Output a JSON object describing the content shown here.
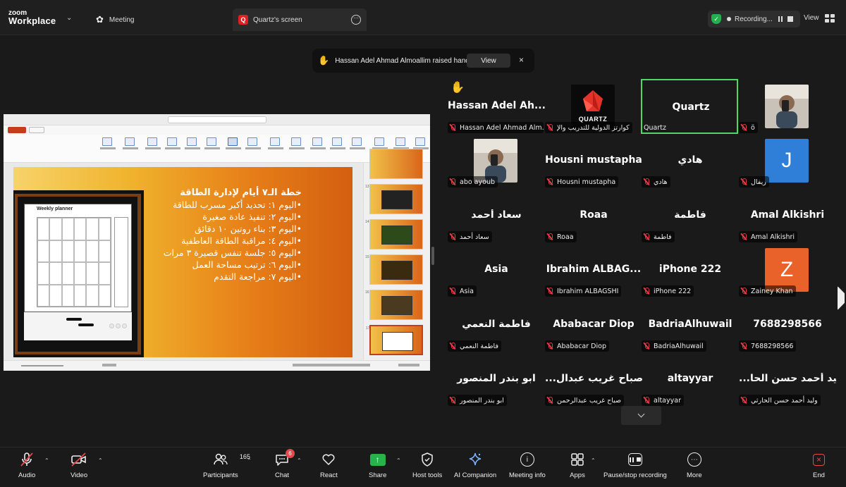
{
  "app": {
    "logo_line1": "zoom",
    "logo_line2": "Workplace"
  },
  "tabs": {
    "meeting": "Meeting",
    "screen": "Quartz's screen",
    "screen_icon_letter": "Q"
  },
  "recording": {
    "label": "Recording...",
    "view_label": "View"
  },
  "notification": {
    "text": "Hassan Adel Ahmad Almoallim raised hand",
    "view_button": "View",
    "close": "×"
  },
  "shared_slide": {
    "title": "خطة الـ٧ أيام لإدارة الطاقة",
    "lines": [
      "•اليوم ١: تحديد أكبر مسرب للطاقة",
      "•اليوم ٢: تنفيذ عادة صغيرة",
      "•اليوم ٣: بناء روتين ١٠ دقائق",
      "•اليوم ٤: مراقبة الطاقة العاطفية",
      "•اليوم ٥: جلسة تنفس قصيرة ٣ مرات",
      "•اليوم ٦: ترتيب مساحة العمل",
      "•اليوم ٧: مراجعة التقدم"
    ],
    "planner_title": "Weekly planner",
    "thumb_numbers": [
      "13",
      "14",
      "15",
      "16",
      "17"
    ]
  },
  "participants": [
    {
      "name": "Hassan  Adel  Ah...",
      "label": "Hassan Adel Ahmad Alm...",
      "raised_hand": true
    },
    {
      "name": "",
      "label": "كوارتز الدولية للتدريب والإ",
      "avatar_type": "quartz-logo",
      "logo_text": "QUARTZ"
    },
    {
      "name": "Quartz",
      "label": "Quartz",
      "active_speaker": true
    },
    {
      "name": "",
      "label": "ö",
      "avatar_type": "photo"
    },
    {
      "name": "",
      "label": "abo ayoub",
      "avatar_type": "photo"
    },
    {
      "name": "Housni mustapha",
      "label": "Housni mustapha"
    },
    {
      "name": "هادي",
      "label": "هادي"
    },
    {
      "name": "",
      "label": "ريفال",
      "avatar_type": "letter",
      "letter": "J",
      "color": "#2f7fd8"
    },
    {
      "name": "سعاد أحمد",
      "label": "سعاد أحمد"
    },
    {
      "name": "Roaa",
      "label": "Roaa"
    },
    {
      "name": "فاطمة",
      "label": "فاطمة"
    },
    {
      "name": "Amal Alkishri",
      "label": "Amal Alkishri"
    },
    {
      "name": "Asia",
      "label": "Asia"
    },
    {
      "name": "Ibrahim  ALBAG...",
      "label": "Ibrahim ALBAGSHI"
    },
    {
      "name": "iPhone 222",
      "label": "iPhone 222"
    },
    {
      "name": "",
      "label": "Zainey Khan",
      "avatar_type": "letter",
      "letter": "Z",
      "color": "#e8622a"
    },
    {
      "name": "فاطمة النعمي",
      "label": "فاطمة النعمي"
    },
    {
      "name": "Ababacar Diop",
      "label": "Ababacar Diop"
    },
    {
      "name": "BadriaAlhuwail",
      "label": "BadriaAlhuwail"
    },
    {
      "name": "7688298566",
      "label": "7688298566"
    },
    {
      "name": "ابو بندر المنصور",
      "label": "ابو بندر المنصور"
    },
    {
      "name": "...صباح غريب عبدال",
      "label": "صباح غريب عبدالرحمن"
    },
    {
      "name": "altayyar",
      "label": "altayyar"
    },
    {
      "name": "...وليد أحمد حسن الحا",
      "label": "وليد أحمد حسن الحارثي"
    }
  ],
  "toolbar": {
    "audio": "Audio",
    "video": "Video",
    "participants": "Participants",
    "participants_count": "165",
    "chat": "Chat",
    "chat_badge": "6",
    "react": "React",
    "share": "Share",
    "host_tools": "Host tools",
    "ai_companion": "AI Companion",
    "meeting_info": "Meeting info",
    "apps": "Apps",
    "pause_recording": "Pause/stop recording",
    "more": "More",
    "end": "End"
  }
}
